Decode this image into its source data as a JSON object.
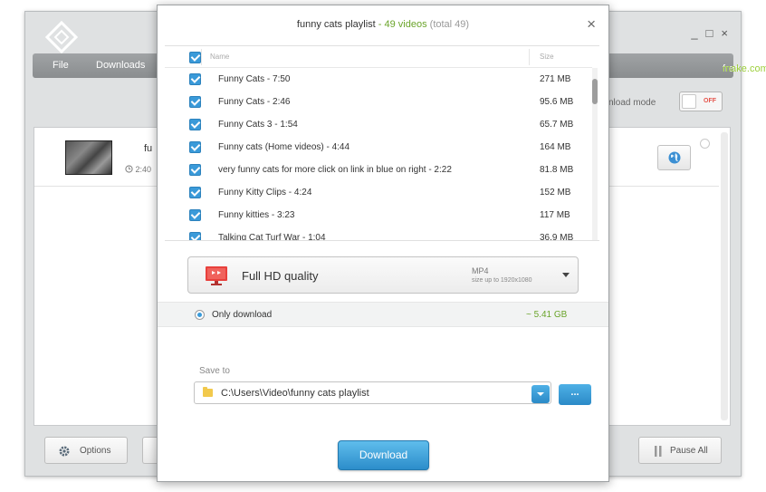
{
  "app": {
    "window_controls": [
      "_",
      "□",
      "×"
    ],
    "menu": {
      "file": "File",
      "downloads": "Downloads"
    },
    "brand": {
      "part1": "free",
      "part2": "make.com"
    },
    "download_mode_label": "nload mode",
    "toggle_state": "OFF",
    "video": {
      "title_fragment": "fu",
      "duration_fragment": "2:40"
    },
    "options_label": "Options",
    "pause_all_label": "Pause All",
    "icons": {
      "logo": "diamond-logo-icon",
      "globe": "globe-icon",
      "gear": "gear-icon",
      "pause": "pause-icon",
      "clock": "clock-icon"
    }
  },
  "dialog": {
    "title_main": "funny cats playlist",
    "title_count": " - 49 videos",
    "title_total": " (total 49)",
    "close": "×",
    "columns": {
      "name": "Name",
      "size": "Size"
    },
    "items": [
      {
        "name": "Funny Cats - 7:50",
        "size": "271 MB"
      },
      {
        "name": "Funny Cats - 2:46",
        "size": "95.6 MB"
      },
      {
        "name": "Funny Cats 3 - 1:54",
        "size": "65.7 MB"
      },
      {
        "name": "Funny cats (Home videos) - 4:44",
        "size": "164 MB"
      },
      {
        "name": "very funny cats for more click on link in blue on right - 2:22",
        "size": "81.8 MB"
      },
      {
        "name": "Funny Kitty Clips - 4:24",
        "size": "152 MB"
      },
      {
        "name": "Funny kitties - 3:23",
        "size": "117 MB"
      },
      {
        "name": "Talking Cat Turf War - 1:04",
        "size": "36.9 MB"
      }
    ],
    "quality": {
      "title": "Full HD quality",
      "format": "MP4",
      "resolution": "size up to 1920x1080"
    },
    "only_download": {
      "label": "Only download",
      "size": "~ 5.41 GB"
    },
    "save_to": {
      "label": "Save to",
      "path": "C:\\Users\\Video\\funny cats playlist",
      "browse": "..."
    },
    "download_label": "Download",
    "colors": {
      "accent": "#3a9ad9",
      "green": "#6aa42a"
    }
  }
}
